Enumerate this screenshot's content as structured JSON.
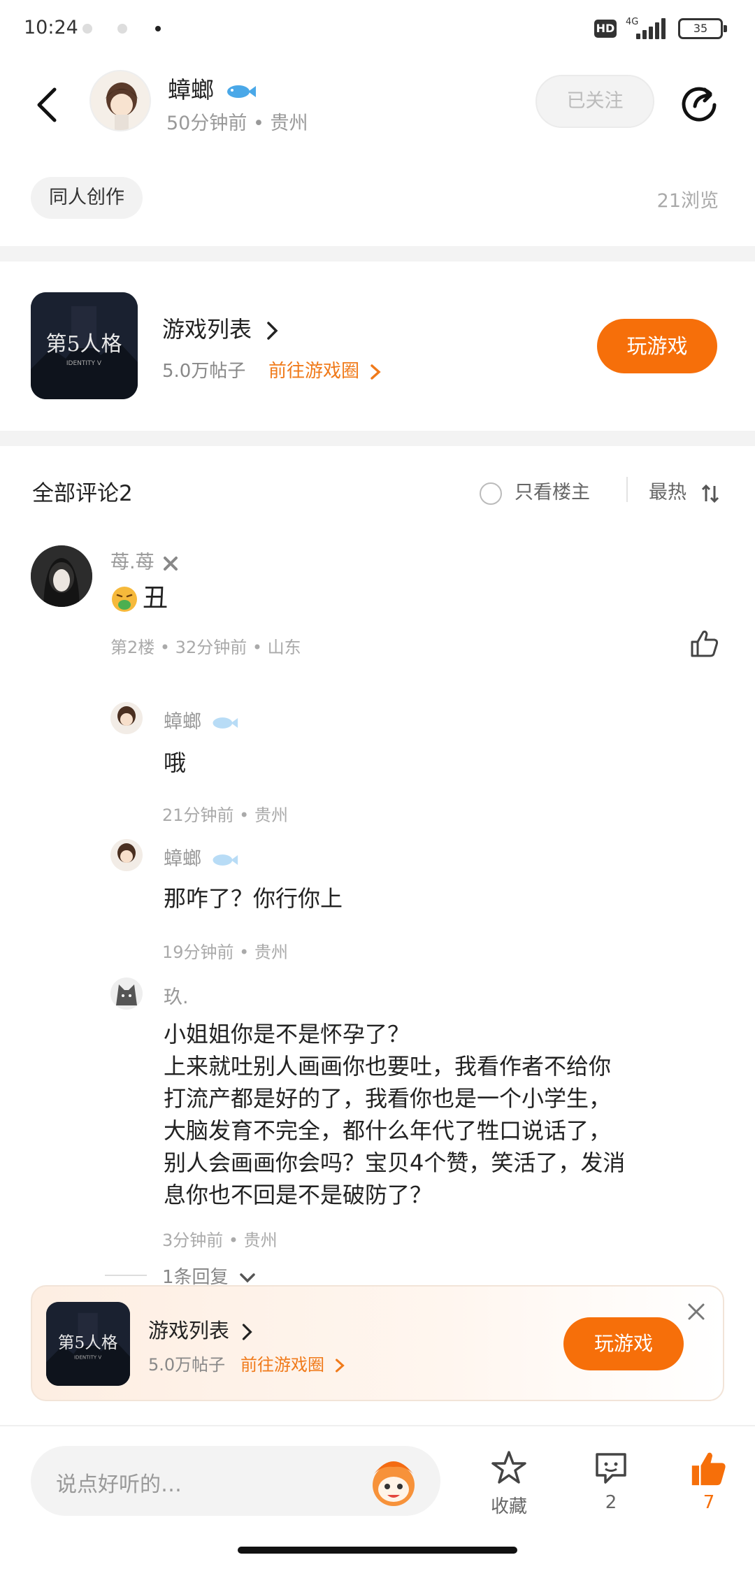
{
  "status_bar": {
    "time": "10:24",
    "hd": "HD",
    "network": "4G",
    "battery": "35"
  },
  "header": {
    "author_name": "蟑螂",
    "author_meta": "50分钟前 • 贵州",
    "follow_label": "已关注"
  },
  "post": {
    "tag": "同人创作",
    "views": "21浏览"
  },
  "game": {
    "icon_text": "第5人格",
    "title": "游戏列表",
    "posts": "5.0万帖子",
    "link": "前往游戏圈",
    "play": "玩游戏"
  },
  "comments": {
    "header": "全部评论2",
    "only_op": "只看楼主",
    "sort": "最热",
    "items": [
      {
        "name": "苺.苺",
        "text": "丑",
        "meta": "第2楼 • 32分钟前 • 山东",
        "replies": [
          {
            "name": "蟑螂",
            "text": "哦",
            "meta": "21分钟前 • 贵州"
          },
          {
            "name": "蟑螂",
            "text": "那咋了？你行你上",
            "meta": "19分钟前 • 贵州"
          },
          {
            "name": "玖.",
            "text_lines": [
              "小姐姐你是不是怀孕了？",
              "上来就吐别人画画你也要吐，我看作者不给你",
              "打流产都是好的了，我看你也是一个小学生，",
              "大脑发育不完全，都什么年代了牲口说话了，",
              "别人会画画你会吗？宝贝4个赞，笑活了，发消",
              "息你也不回是不是破防了？"
            ],
            "meta": "3分钟前 • 贵州"
          }
        ],
        "more_replies": "1条回复"
      }
    ]
  },
  "floating_card": {
    "title": "游戏列表",
    "posts": "5.0万帖子",
    "link": "前往游戏圈",
    "play": "玩游戏"
  },
  "bottom_bar": {
    "input_placeholder": "说点好听的…",
    "favorite_label": "收藏",
    "comment_count": "2",
    "like_count": "7"
  },
  "colors": {
    "accent": "#f66f0a",
    "link": "#f07a1a"
  }
}
